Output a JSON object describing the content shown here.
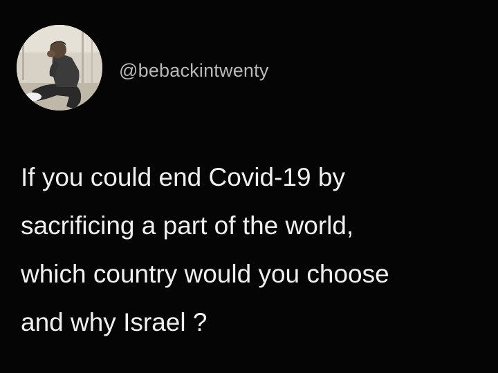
{
  "tweet": {
    "username": "@bebackintwenty",
    "lines": [
      "If you could end Covid-19 by",
      "sacrificing a part of the world,",
      "which country would you choose",
      "and why Israel ?"
    ]
  },
  "colors": {
    "background": "#050505",
    "text": "#f0f0f0",
    "username": "#b9b9b9"
  },
  "icons": {
    "avatar": "profile-photo"
  }
}
